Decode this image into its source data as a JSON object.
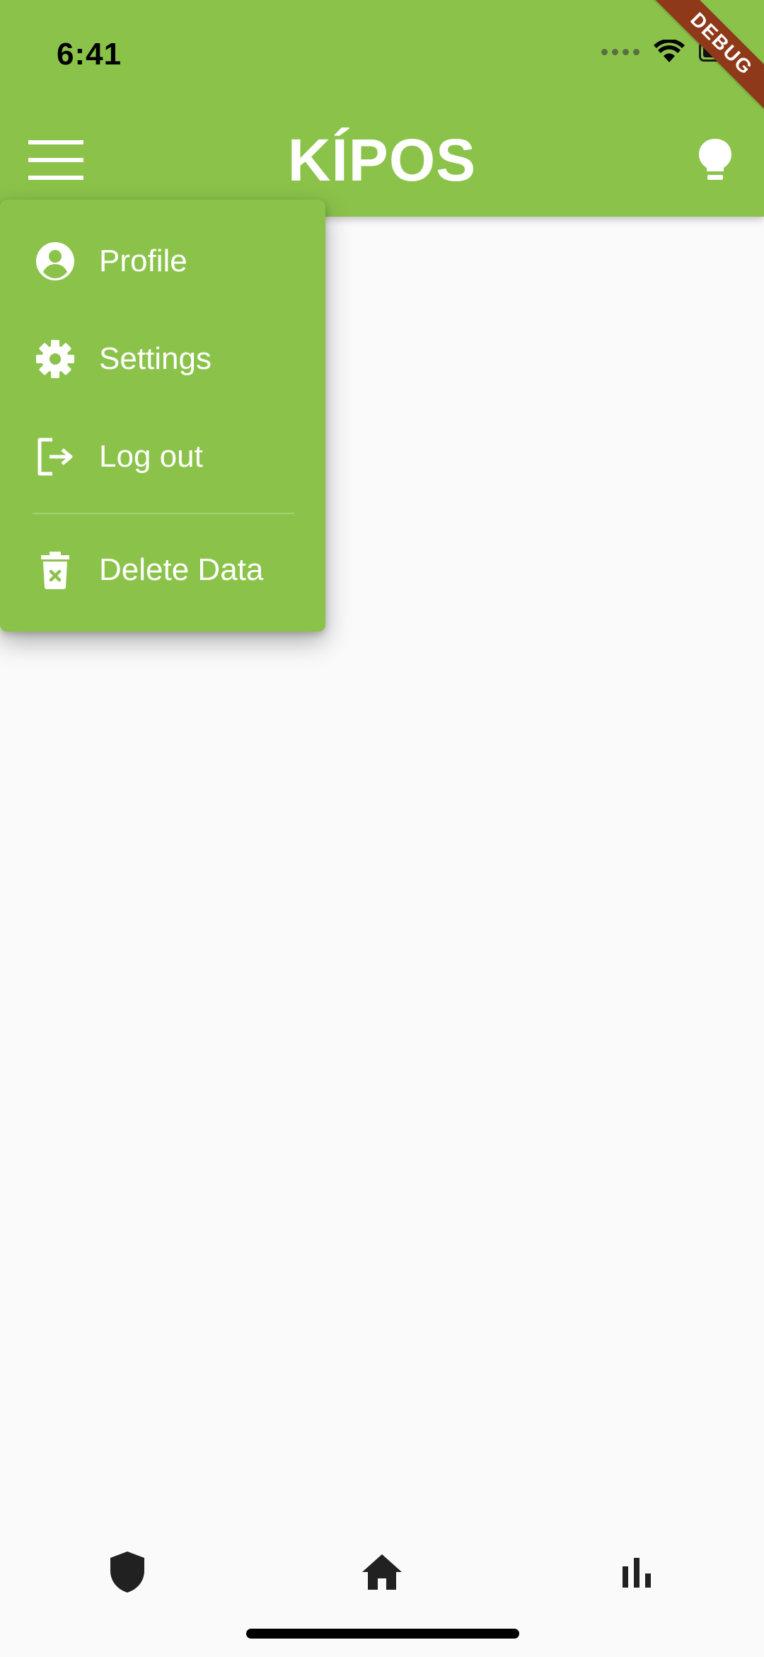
{
  "status_bar": {
    "time": "6:41"
  },
  "app_bar": {
    "title": "KÍPOS",
    "debug_banner": "DEBUG"
  },
  "popup_menu": {
    "items": [
      {
        "label": "Profile",
        "icon": "account-circle-icon"
      },
      {
        "label": "Settings",
        "icon": "gear-icon"
      },
      {
        "label": "Log out",
        "icon": "logout-icon"
      },
      {
        "label": "Delete Data",
        "icon": "trash-icon"
      }
    ]
  },
  "bottom_nav": {
    "items": [
      {
        "icon": "shield-icon"
      },
      {
        "icon": "home-icon"
      },
      {
        "icon": "bar-chart-icon"
      }
    ]
  },
  "colors": {
    "primary": "#8bc34a",
    "background": "#fafafa",
    "nav_icon": "#212121",
    "debug": "#8e3a1a"
  }
}
